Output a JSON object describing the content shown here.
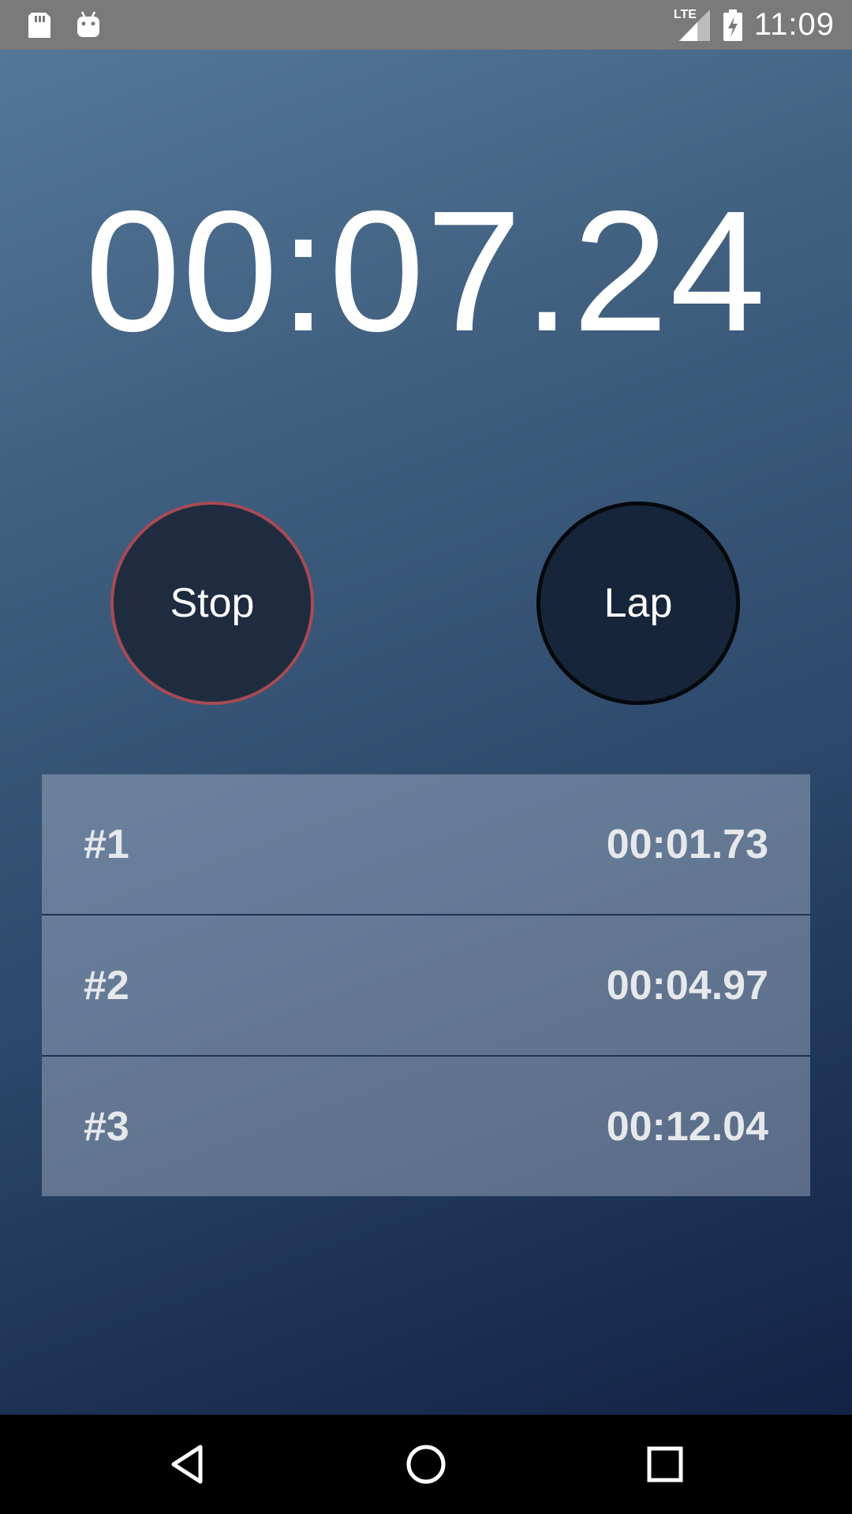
{
  "status_bar": {
    "time": "11:09",
    "network_label": "LTE",
    "icons": [
      "sd-card-icon",
      "android-icon",
      "lte-signal-icon",
      "battery-charging-icon"
    ]
  },
  "stopwatch": {
    "elapsed": "00:07.24"
  },
  "controls": {
    "stop_label": "Stop",
    "lap_label": "Lap"
  },
  "laps": [
    {
      "number": "#1",
      "time": "00:01.73"
    },
    {
      "number": "#2",
      "time": "00:04.97"
    },
    {
      "number": "#3",
      "time": "00:12.04"
    }
  ],
  "nav_bar": {
    "icons": [
      "back-icon",
      "home-icon",
      "recents-icon"
    ]
  },
  "colors": {
    "stop_ring": "#a84a55",
    "status_bar": "#7a7a7a",
    "nav_bar": "#000000"
  }
}
